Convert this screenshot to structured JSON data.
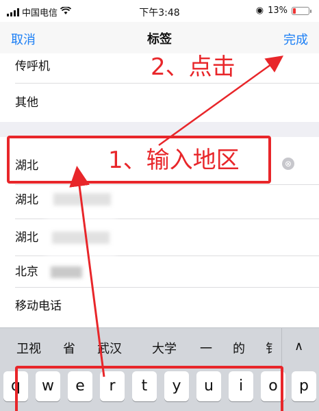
{
  "status_bar": {
    "carrier": "中国电信",
    "time": "下午3:48",
    "battery_pct": "13%"
  },
  "nav": {
    "cancel": "取消",
    "title": "标签",
    "done": "完成"
  },
  "list": {
    "items": [
      "传呼机",
      "其他"
    ],
    "search_results": [
      "湖北",
      "湖北",
      "湖北",
      "北京",
      "移动电话"
    ],
    "clear_icon": "⊗"
  },
  "suggestions": [
    "卫视",
    "省",
    "武汉",
    "大学",
    "一",
    "的",
    "钅"
  ],
  "suggest_toggle": "∧",
  "keyboard": {
    "row1": [
      "q",
      "w",
      "e",
      "r",
      "t",
      "y",
      "u",
      "i",
      "o",
      "p"
    ]
  },
  "annotations": {
    "step1": "1、输入地区",
    "step2": "2、点击",
    "color": "#e8262a"
  }
}
